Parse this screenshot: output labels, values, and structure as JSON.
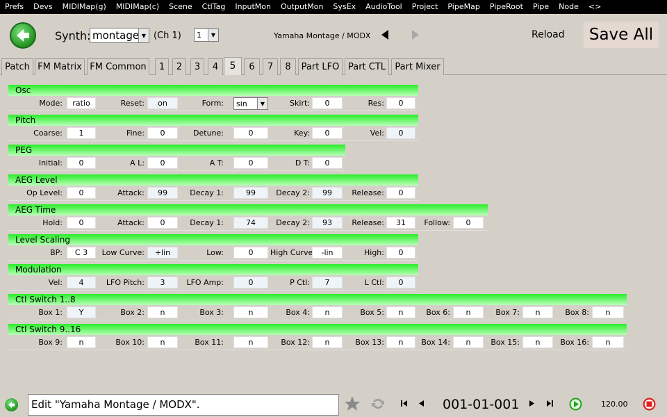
{
  "menubar": [
    "Prefs",
    "Devs",
    "MIDIMap(g)",
    "MIDIMap(c)",
    "Scene",
    "CtlTag",
    "InputMon",
    "OutputMon",
    "SysEx",
    "AudioTool",
    "Project",
    "PipeMap",
    "PipeRoot",
    "Pipe",
    "Node",
    "<>"
  ],
  "toolbar": {
    "synth_label": "Synth:",
    "synth_value": "montage",
    "channel_label": "(Ch 1)",
    "part_value": "1",
    "device_title": "Yamaha Montage / MODX",
    "reload_label": "Reload",
    "save_all_label": "Save All"
  },
  "tabs": [
    "Patch",
    "FM Matrix",
    "FM Common",
    "1",
    "2",
    "3",
    "4",
    "5",
    "6",
    "7",
    "8",
    "Part LFO",
    "Part CTL",
    "Part Mixer"
  ],
  "active_tab": "5",
  "sections": {
    "osc": {
      "title": "Osc",
      "fields": [
        {
          "label": "Mode:",
          "value": "ratio"
        },
        {
          "label": "Reset:",
          "value": "on"
        },
        {
          "label": "Form:",
          "value": "sin"
        },
        {
          "label": "Skirt:",
          "value": "0"
        },
        {
          "label": "Res:",
          "value": "0"
        }
      ]
    },
    "pitch": {
      "title": "Pitch",
      "fields": [
        {
          "label": "Coarse:",
          "value": "1"
        },
        {
          "label": "Fine:",
          "value": "0"
        },
        {
          "label": "Detune:",
          "value": "0"
        },
        {
          "label": "Key:",
          "value": "0"
        },
        {
          "label": "Vel:",
          "value": "0"
        }
      ]
    },
    "peg": {
      "title": "PEG",
      "fields": [
        {
          "label": "Initial:",
          "value": "0"
        },
        {
          "label": "A L:",
          "value": "0"
        },
        {
          "label": "A T:",
          "value": "0"
        },
        {
          "label": "D T:",
          "value": "0"
        }
      ]
    },
    "aeg_level": {
      "title": "AEG Level",
      "fields": [
        {
          "label": "Op Level:",
          "value": "0"
        },
        {
          "label": "Attack:",
          "value": "99"
        },
        {
          "label": "Decay 1:",
          "value": "99"
        },
        {
          "label": "Decay 2:",
          "value": "99"
        },
        {
          "label": "Release:",
          "value": "0"
        }
      ]
    },
    "aeg_time": {
      "title": "AEG Time",
      "fields": [
        {
          "label": "Hold:",
          "value": "0"
        },
        {
          "label": "Attack:",
          "value": "0"
        },
        {
          "label": "Decay 1:",
          "value": "74"
        },
        {
          "label": "Decay 2:",
          "value": "93"
        },
        {
          "label": "Release:",
          "value": "31"
        },
        {
          "label": "Follow:",
          "value": "0"
        }
      ]
    },
    "level_scaling": {
      "title": "Level Scaling",
      "fields": [
        {
          "label": "BP:",
          "value": "C 3"
        },
        {
          "label": "Low Curve:",
          "value": "+lin"
        },
        {
          "label": "Low:",
          "value": "0"
        },
        {
          "label": "High Curve:",
          "value": "-lin"
        },
        {
          "label": "High:",
          "value": "0"
        }
      ]
    },
    "modulation": {
      "title": "Modulation",
      "fields": [
        {
          "label": "Vel:",
          "value": "4"
        },
        {
          "label": "LFO Pitch:",
          "value": "3"
        },
        {
          "label": "LFO Amp:",
          "value": "0"
        },
        {
          "label": "P Ctl:",
          "value": "7"
        },
        {
          "label": "L Ctl:",
          "value": "0"
        }
      ]
    },
    "ctl_switch_1_8": {
      "title": "Ctl Switch 1..8",
      "fields": [
        {
          "label": "Box 1:",
          "value": "Y"
        },
        {
          "label": "Box 2:",
          "value": "n"
        },
        {
          "label": "Box 3:",
          "value": "n"
        },
        {
          "label": "Box 4:",
          "value": "n"
        },
        {
          "label": "Box 5:",
          "value": "n"
        },
        {
          "label": "Box 6:",
          "value": "n"
        },
        {
          "label": "Box 7:",
          "value": "n"
        },
        {
          "label": "Box 8:",
          "value": "n"
        }
      ]
    },
    "ctl_switch_9_16": {
      "title": "Ctl Switch 9..16",
      "fields": [
        {
          "label": "Box 9:",
          "value": "n"
        },
        {
          "label": "Box 10:",
          "value": "n"
        },
        {
          "label": "Box 11:",
          "value": "n"
        },
        {
          "label": "Box 12:",
          "value": "n"
        },
        {
          "label": "Box 13:",
          "value": "n"
        },
        {
          "label": "Box 14:",
          "value": "n"
        },
        {
          "label": "Box 15:",
          "value": "n"
        },
        {
          "label": "Box 16:",
          "value": "n"
        }
      ]
    }
  },
  "statusbar": {
    "message": "Edit \"Yamaha Montage / MODX\".",
    "position": "001-01-001",
    "tempo": "120.00"
  },
  "colors": {
    "section_header_start": "#28ed28",
    "section_header_end": "#b7ffb7",
    "menubar_bg": "#000000",
    "window_bg": "#d4d0c8",
    "play_green": "#1fa31f",
    "stop_red": "#e02020"
  },
  "icons": [
    "back-arrow-icon",
    "chevron-down-icon",
    "triangle-left-icon",
    "triangle-right-icon",
    "star-icon",
    "sync-icon",
    "skip-first-icon",
    "step-back-icon",
    "step-forward-icon",
    "skip-last-icon",
    "play-icon",
    "stop-icon"
  ]
}
